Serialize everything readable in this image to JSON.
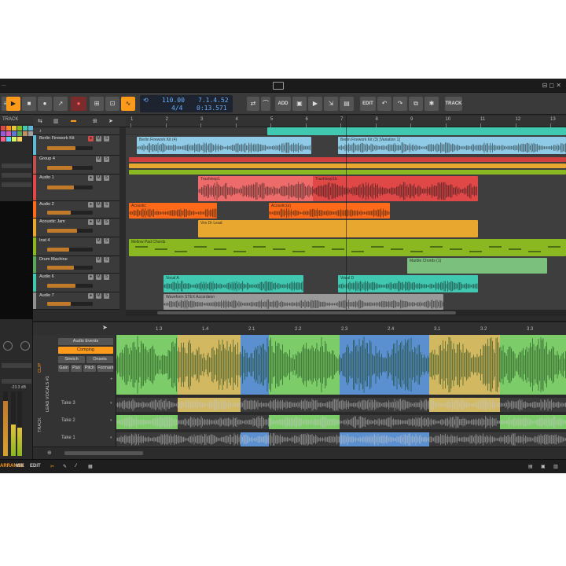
{
  "titlebar": {
    "title": "...",
    "window_controls": "⊟ ◻ ✕"
  },
  "toolbar": {
    "tempo": "110.00",
    "signature": "4/4",
    "position": "7.1.4.52",
    "time": "0:13.571",
    "add_label": "ADD",
    "edit_label": "EDIT",
    "track_label": "TRACK"
  },
  "inspector": {
    "header": "TRACK",
    "db_value": "-23.3 dB"
  },
  "ruler": {
    "bars": [
      "1",
      "2",
      "3",
      "4",
      "5",
      "6",
      "7",
      "8",
      "9",
      "10",
      "11",
      "12",
      "13"
    ]
  },
  "tracks": [
    {
      "name": "Berlin Firework Kit",
      "color": "#5fb8d8"
    },
    {
      "name": "Group 4",
      "color": "#c05050"
    },
    {
      "name": "Audio 1",
      "color": "#e04848"
    },
    {
      "name": "Audio 2",
      "color": "#ff6a1a"
    },
    {
      "name": "Acoustic Jam",
      "color": "#e8a830"
    },
    {
      "name": "Inst 4",
      "color": "#8ab820"
    },
    {
      "name": "Drum Machine",
      "color": "#58a85a"
    },
    {
      "name": "Audio 6",
      "color": "#40c8b0"
    },
    {
      "name": "Audio 7",
      "color": "#909090"
    }
  ],
  "clips": {
    "kit_a": "Berlin Firework Kit (4)",
    "kit_b": "Berlin Firework Kit (3) [Variation 1]",
    "audio1_a": "Trashloop1",
    "audio1_b": "Trashloop1b",
    "audio2_a": "Acoustic",
    "audio2_b": "Acoustic(a)",
    "jam": "Vox Dr Lead",
    "inst": "Mellow Pad Chords",
    "drum": "Marble Chords (1)",
    "vocal_a": "Vocal A",
    "vocal_b": "Vocal D",
    "audio7": "Waveform STEX Accordeon"
  },
  "editor": {
    "ruler": [
      "1.3",
      "1.4",
      "2.1",
      "2.2",
      "2.3",
      "2.4",
      "3.1",
      "3.2",
      "3.3"
    ],
    "buttons": {
      "audio_events": "Audio Events",
      "comping": "Comping",
      "stretch": "Stretch",
      "onsets": "Onsets",
      "gain": "Gain",
      "pan": "Pan",
      "pitch": "Pitch",
      "formant": "Formant"
    },
    "takes": [
      "Take 3",
      "Take 2",
      "Take 1"
    ],
    "lane_title": "LEAD VOCALS #1",
    "side_label": "TRACK",
    "clip_label": "CLIP"
  },
  "statusbar": {
    "arrange": "ARRANGE",
    "mix": "MIX",
    "edit": "EDIT"
  }
}
